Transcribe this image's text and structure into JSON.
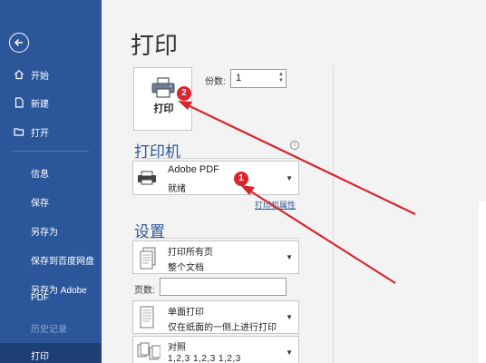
{
  "sidebar": {
    "items": [
      {
        "label": "开始",
        "icon": "home-icon"
      },
      {
        "label": "新建",
        "icon": "new-doc-icon"
      },
      {
        "label": "打开",
        "icon": "folder-icon"
      }
    ],
    "sub_items": [
      "信息",
      "保存",
      "另存为",
      "保存到百度网盘",
      "另存为 Adobe",
      "PDF",
      "历史记录",
      "打印"
    ]
  },
  "main": {
    "title": "打印",
    "print_button_label": "打印",
    "copies_label": "份数:",
    "copies_value": "1",
    "printer_section_title": "打印机",
    "printer_name": "Adobe PDF",
    "printer_status": "就绪",
    "printer_properties_link": "打印机属性",
    "settings_section_title": "设置",
    "print_range_main": "打印所有页",
    "print_range_sub": "整个文档",
    "pages_label": "页数:",
    "pages_value": "",
    "sides_main": "单面打印",
    "sides_sub": "仅在纸面的一侧上进行打印",
    "collate_main": "对照",
    "collate_sub": "1,2,3    1,2,3    1,2,3"
  },
  "annotations": {
    "badge1": "1",
    "badge2": "2",
    "accent": "#d7262e"
  },
  "colors": {
    "sidebar": "#2b579a",
    "accent": "#2b579a"
  }
}
